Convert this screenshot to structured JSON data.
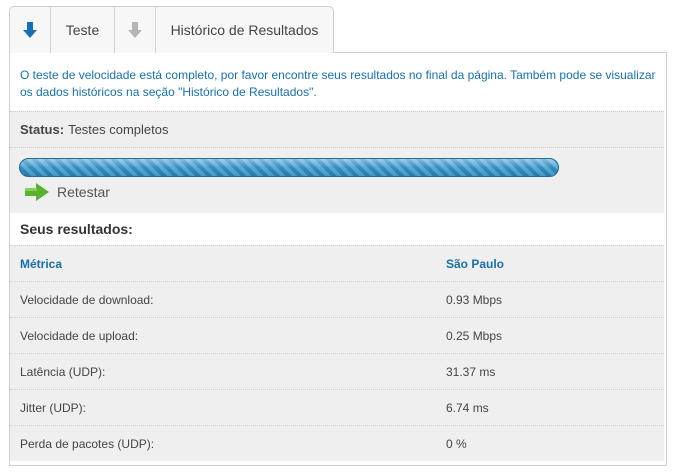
{
  "tabs": {
    "test_label": "Teste",
    "history_label": "Histórico de Resultados",
    "icons": [
      "download-arrow-icon",
      "download-arrow-gray-icon"
    ]
  },
  "intro_text": "O teste de velocidade está completo, por favor encontre seus resultados no final da página. Também pode se visualizar os dados históricos na seção \"Histórico de Resultados\".",
  "status": {
    "label": "Status:",
    "value": "Testes completos",
    "progress": 1.0
  },
  "retest": {
    "label": "Retestar",
    "icon": "green-arrow-right-icon"
  },
  "results_title": "Seus resultados:",
  "table": {
    "headers": [
      "Métrica",
      "São Paulo"
    ],
    "rows": [
      {
        "metric": "Velocidade de download:",
        "value": "0.93 Mbps"
      },
      {
        "metric": "Velocidade de upload:",
        "value": "0.25 Mbps"
      },
      {
        "metric": "Latência (UDP):",
        "value": "31.37 ms"
      },
      {
        "metric": "Jitter (UDP):",
        "value": "6.74 ms"
      },
      {
        "metric": "Perda de pacotes (UDP):",
        "value": "0 %"
      }
    ]
  },
  "colors": {
    "accent": "#1a6fa4",
    "progress_bar": "#2d86bb",
    "retest_arrow": "#5ab030",
    "panel_bg": "#efefef"
  }
}
